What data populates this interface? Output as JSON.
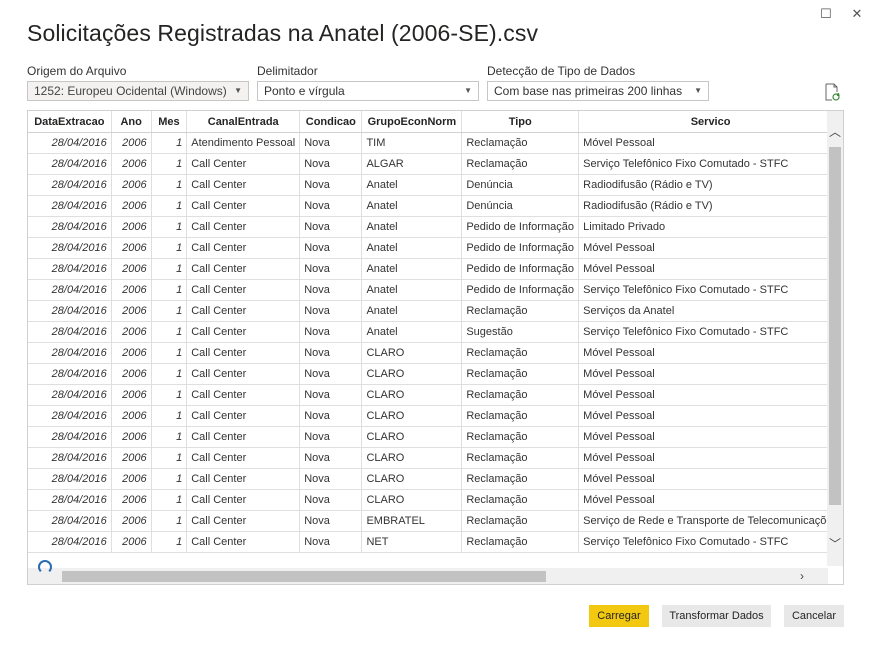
{
  "window": {
    "title": "Solicitações Registradas na Anatel (2006-SE).csv",
    "maximize_glyph": "☐",
    "close_glyph": "✕"
  },
  "options": {
    "origin": {
      "label": "Origem do Arquivo",
      "value": "1252: Europeu Ocidental (Windows)"
    },
    "delimiter": {
      "label": "Delimitador",
      "value": "Ponto e vírgula"
    },
    "detection": {
      "label": "Detecção de Tipo de Dados",
      "value": "Com base nas primeiras 200 linhas"
    }
  },
  "table": {
    "columns": [
      "DataExtracao",
      "Ano",
      "Mes",
      "CanalEntrada",
      "Condicao",
      "GrupoEconNorm",
      "Tipo",
      "Servico"
    ],
    "rows": [
      [
        "28/04/2016",
        "2006",
        "1",
        "Atendimento Pessoal",
        "Nova",
        "TIM",
        "Reclamação",
        "Móvel Pessoal"
      ],
      [
        "28/04/2016",
        "2006",
        "1",
        "Call Center",
        "Nova",
        "ALGAR",
        "Reclamação",
        "Serviço Telefônico Fixo Comutado - STFC"
      ],
      [
        "28/04/2016",
        "2006",
        "1",
        "Call Center",
        "Nova",
        "Anatel",
        "Denúncia",
        "Radiodifusão (Rádio e TV)"
      ],
      [
        "28/04/2016",
        "2006",
        "1",
        "Call Center",
        "Nova",
        "Anatel",
        "Denúncia",
        "Radiodifusão (Rádio e TV)"
      ],
      [
        "28/04/2016",
        "2006",
        "1",
        "Call Center",
        "Nova",
        "Anatel",
        "Pedido de Informação",
        "Limitado Privado"
      ],
      [
        "28/04/2016",
        "2006",
        "1",
        "Call Center",
        "Nova",
        "Anatel",
        "Pedido de Informação",
        "Móvel Pessoal"
      ],
      [
        "28/04/2016",
        "2006",
        "1",
        "Call Center",
        "Nova",
        "Anatel",
        "Pedido de Informação",
        "Móvel Pessoal"
      ],
      [
        "28/04/2016",
        "2006",
        "1",
        "Call Center",
        "Nova",
        "Anatel",
        "Pedido de Informação",
        "Serviço Telefônico Fixo Comutado - STFC"
      ],
      [
        "28/04/2016",
        "2006",
        "1",
        "Call Center",
        "Nova",
        "Anatel",
        "Reclamação",
        "Serviços da Anatel"
      ],
      [
        "28/04/2016",
        "2006",
        "1",
        "Call Center",
        "Nova",
        "Anatel",
        "Sugestão",
        "Serviço Telefônico Fixo Comutado - STFC"
      ],
      [
        "28/04/2016",
        "2006",
        "1",
        "Call Center",
        "Nova",
        "CLARO",
        "Reclamação",
        "Móvel Pessoal"
      ],
      [
        "28/04/2016",
        "2006",
        "1",
        "Call Center",
        "Nova",
        "CLARO",
        "Reclamação",
        "Móvel Pessoal"
      ],
      [
        "28/04/2016",
        "2006",
        "1",
        "Call Center",
        "Nova",
        "CLARO",
        "Reclamação",
        "Móvel Pessoal"
      ],
      [
        "28/04/2016",
        "2006",
        "1",
        "Call Center",
        "Nova",
        "CLARO",
        "Reclamação",
        "Móvel Pessoal"
      ],
      [
        "28/04/2016",
        "2006",
        "1",
        "Call Center",
        "Nova",
        "CLARO",
        "Reclamação",
        "Móvel Pessoal"
      ],
      [
        "28/04/2016",
        "2006",
        "1",
        "Call Center",
        "Nova",
        "CLARO",
        "Reclamação",
        "Móvel Pessoal"
      ],
      [
        "28/04/2016",
        "2006",
        "1",
        "Call Center",
        "Nova",
        "CLARO",
        "Reclamação",
        "Móvel Pessoal"
      ],
      [
        "28/04/2016",
        "2006",
        "1",
        "Call Center",
        "Nova",
        "CLARO",
        "Reclamação",
        "Móvel Pessoal"
      ],
      [
        "28/04/2016",
        "2006",
        "1",
        "Call Center",
        "Nova",
        "EMBRATEL",
        "Reclamação",
        "Serviço de Rede e Transporte de Telecomunicações"
      ],
      [
        "28/04/2016",
        "2006",
        "1",
        "Call Center",
        "Nova",
        "NET",
        "Reclamação",
        "Serviço Telefônico Fixo Comutado - STFC"
      ]
    ]
  },
  "buttons": {
    "load": "Carregar",
    "transform": "Transformar Dados",
    "cancel": "Cancelar"
  },
  "colors": {
    "accent": "#f2c811"
  }
}
